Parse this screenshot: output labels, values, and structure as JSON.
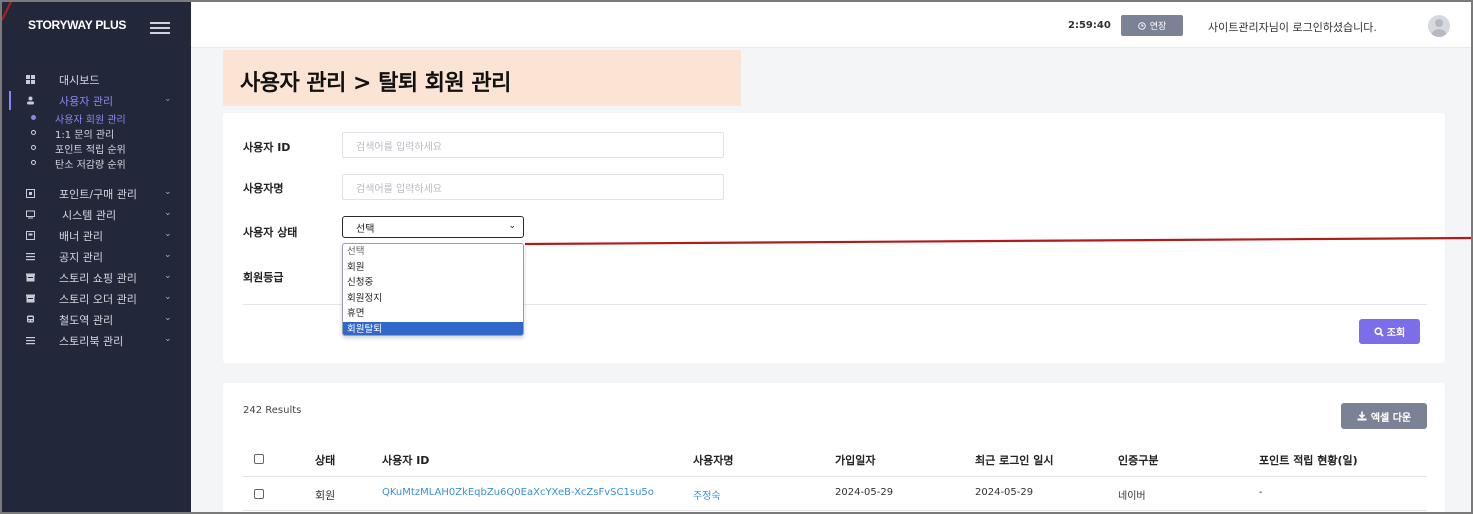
{
  "sidebar": {
    "brand": "STORYWAY PLUS",
    "items": [
      {
        "label": "대시보드",
        "icon": "dashboard-icon",
        "chevron": false
      },
      {
        "label": "사용자 관리",
        "icon": "user-icon",
        "chevron": true,
        "active": true
      },
      {
        "label": "포인트/구매 관리",
        "icon": "point-icon",
        "chevron": true
      },
      {
        "label": "시스템 관리",
        "icon": "monitor-icon",
        "chevron": true
      },
      {
        "label": "배너 관리",
        "icon": "banner-icon",
        "chevron": true
      },
      {
        "label": "공지 관리",
        "icon": "list-icon",
        "chevron": true
      },
      {
        "label": "스토리 쇼핑 관리",
        "icon": "shop-icon",
        "chevron": true
      },
      {
        "label": "스토리 오더 관리",
        "icon": "order-icon",
        "chevron": true
      },
      {
        "label": "철도역 관리",
        "icon": "train-icon",
        "chevron": true
      },
      {
        "label": "스토리북 관리",
        "icon": "list-icon",
        "chevron": true
      }
    ],
    "subitems": [
      {
        "label": "사용자 회원 관리",
        "active": true
      },
      {
        "label": "1:1 문의 관리"
      },
      {
        "label": "포인트 적립 순위"
      },
      {
        "label": "탄소 저감량 순위"
      }
    ]
  },
  "topbar": {
    "timer": "2:59:40",
    "extend_label": "연장",
    "login_message": "사이트관리자님이 로그인하셨습니다."
  },
  "page": {
    "title": "사용자 관리 > 탈퇴 회원 관리"
  },
  "search": {
    "user_id_label": "사용자 ID",
    "user_id_placeholder": "검색어를 입력하세요",
    "user_name_label": "사용자명",
    "user_name_placeholder": "검색어를 입력하세요",
    "status_label": "사용자 상태",
    "status_value": "선택",
    "grade_label": "회원등급",
    "search_button": "조회",
    "status_options": [
      "선택",
      "회원",
      "신청중",
      "회원정지",
      "휴면",
      "회원탈퇴"
    ],
    "status_highlighted": "회원탈퇴"
  },
  "results": {
    "count": "242 Results",
    "excel_button": "엑셀 다운",
    "columns": [
      "상태",
      "사용자 ID",
      "사용자명",
      "가입일자",
      "최근 로그인 일시",
      "인증구분",
      "포인트 적립 현황(일)"
    ],
    "rows": [
      {
        "status": "회원",
        "user_id": "QKuMtzMLAH0ZkEqbZu6Q0EaXcYXeB-XcZsFvSC1su5o",
        "user_name": "주정숙",
        "join_date": "2024-05-29",
        "last_login": "2024-05-29",
        "auth_type": "네이버",
        "points": "-"
      }
    ]
  },
  "colors": {
    "sidebar_bg": "#23273a",
    "accent": "#8b86f2",
    "title_banner": "#fce4d4",
    "search_button": "#7b6ee8",
    "annotation": "#b01c1c"
  }
}
